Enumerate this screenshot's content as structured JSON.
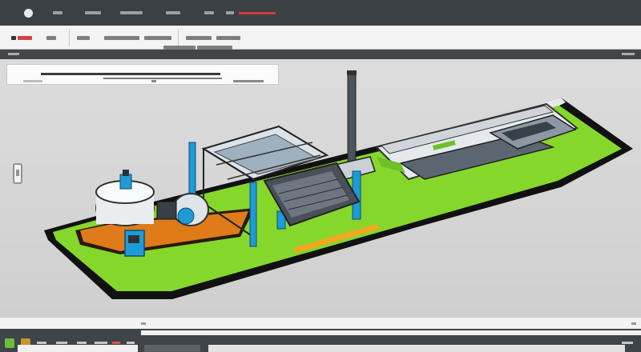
{
  "colors": {
    "titlebar": "#3b4045",
    "ribbon": "#f3f3f3",
    "viewport": "#d4d4d4",
    "platform_green": "#7ed321",
    "accent_blue": "#1e9bd7",
    "accent_orange": "#f5a623",
    "accent_red": "#d63a3a"
  },
  "icons": {
    "app_logo": "app-logo-icon",
    "side_tool": "view-cube-icon",
    "start": "start-icon"
  },
  "scene": {
    "description_label": ""
  }
}
